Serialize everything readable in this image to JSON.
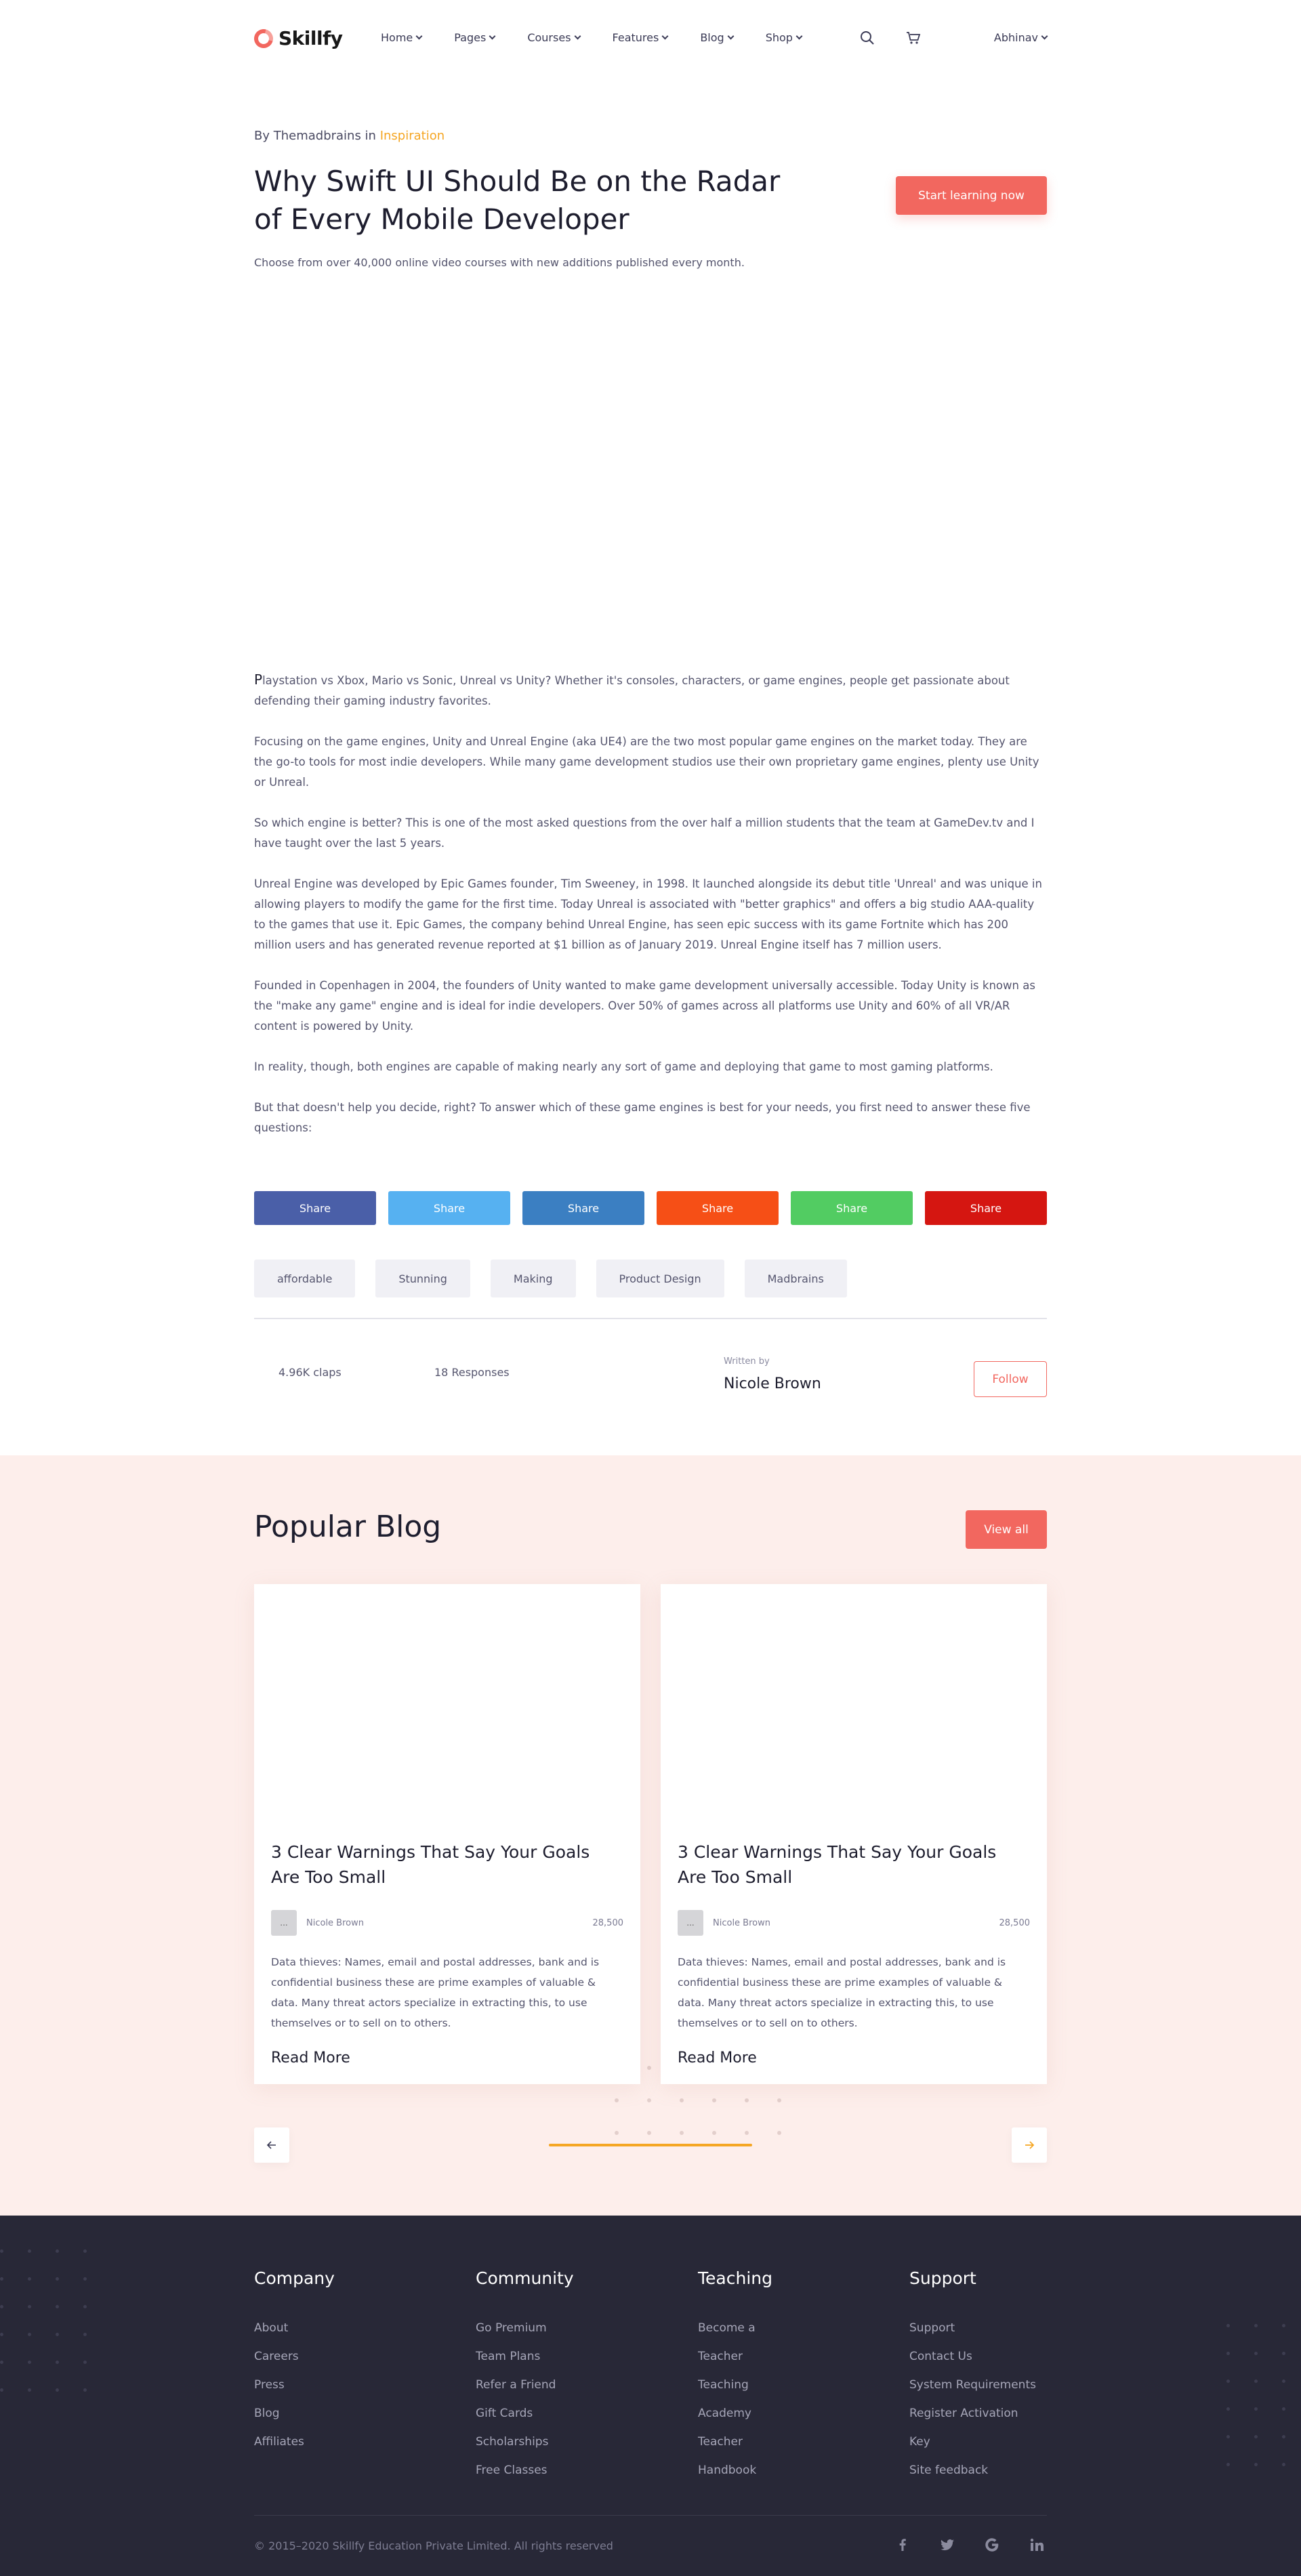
{
  "brand": {
    "name": "Skillfy",
    "accent": "#f2675f",
    "highlight": "#f5a623"
  },
  "nav": {
    "items": [
      "Home",
      "Pages",
      "Courses",
      "Features",
      "Blog",
      "Shop"
    ],
    "search_icon": "search-icon",
    "cart_icon": "cart-icon",
    "user": "Abhinav"
  },
  "hero": {
    "by_prefix": "By Themadbrains in",
    "category": "Inspiration",
    "title": "Why Swift UI Should Be on  the Radar of Every Mobile Developer",
    "subtitle": "Choose from over 40,000 online video courses with new additions published every month.",
    "cta": "Start learning now"
  },
  "article": {
    "dropcap": "P",
    "first_rest": "laystation vs Xbox, Mario vs Sonic, Unreal vs Unity? Whether it's consoles, characters, or game engines, people get passionate about defending their gaming industry favorites.",
    "paragraphs": [
      "Focusing on the game engines, Unity and Unreal Engine (aka UE4) are the two most popular game engines on the market today. They are the go-to tools for most indie developers. While many game development studios use their own proprietary game engines, plenty use Unity or Unreal.",
      "So which engine is better? This is one of the most asked questions from the over half a million students that the team at GameDev.tv and I have taught over the last 5 years.",
      "Unreal Engine was developed by Epic Games founder, Tim Sweeney, in 1998. It launched alongside its debut title 'Unreal' and was unique in allowing players to modify the game for the first time. Today Unreal is associated with \"better graphics\" and offers a big studio AAA-quality to the games that use it. Epic Games, the company behind Unreal Engine, has seen epic success with its game Fortnite which has 200 million users and has generated revenue reported at $1 billion as of January 2019. Unreal Engine itself has 7 million users.",
      "Founded in Copenhagen in 2004, the founders of Unity wanted to make game development universally accessible. Today Unity is known as the \"make any game\" engine and is ideal for indie developers. Over 50% of games across all platforms use Unity and 60% of all VR/AR content is powered by Unity.",
      "In reality, though, both engines are capable of making nearly any sort of game and deploying that game to most gaming platforms.",
      "But that doesn't help you decide, right? To answer which of these game engines is best for your needs, you first need to answer these five questions:"
    ]
  },
  "share": {
    "label": "Share",
    "colors": [
      "#4a5fa8",
      "#56b1f1",
      "#3b7fc2",
      "#f64f16",
      "#52cc62",
      "#d51611"
    ]
  },
  "tags": [
    "affordable",
    "Stunning",
    "Making",
    "Product Design",
    "Madbrains"
  ],
  "author_bar": {
    "claps": "4.96K claps",
    "responses": "18 Responses",
    "written_by": "Written by",
    "author": "Nicole Brown",
    "follow": "Follow"
  },
  "popular": {
    "heading": "Popular Blog",
    "view_all": "View all",
    "cards": [
      {
        "title": "3 Clear Warnings That Say Your Goals Are Too Small",
        "avatar": "...",
        "author": "Nicole Brown",
        "views": "28,500",
        "text": "Data thieves: Names, email and postal addresses, bank and is confidential business these are prime examples of valuable & data. Many threat actors specialize in extracting this, to use themselves or to sell on to others.",
        "read_more": "Read More"
      },
      {
        "title": "3 Clear Warnings That Say Your Goals Are Too Small",
        "avatar": "...",
        "author": "Nicole Brown",
        "views": "28,500",
        "text": "Data thieves: Names, email and postal addresses, bank and is confidential business these are prime examples of valuable & data. Many threat actors specialize in extracting this, to use themselves or to sell on to others.",
        "read_more": "Read More"
      }
    ],
    "prev_icon": "arrow-left-icon",
    "next_icon": "arrow-right-icon"
  },
  "footer": {
    "columns": [
      {
        "title": "Company",
        "links": [
          "About",
          "Careers",
          "Press",
          "Blog",
          "Affiliates"
        ]
      },
      {
        "title": "Community",
        "links": [
          "Go Premium",
          "Team Plans",
          "Refer a Friend",
          "Gift Cards",
          "Scholarships",
          "Free Classes"
        ]
      },
      {
        "title": "Teaching",
        "links": [
          "Become a",
          "Teacher",
          "Teaching",
          "Academy",
          "Teacher",
          "Handbook"
        ]
      },
      {
        "title": "Support",
        "links": [
          "Support",
          "Contact Us",
          "System Requirements",
          "Register Activation",
          "Key",
          "Site feedback"
        ]
      }
    ],
    "copyright": "© 2015–2020 Skillfy Education Private Limited. All rights reserved",
    "social": [
      "facebook-icon",
      "twitter-icon",
      "google-icon",
      "linkedin-icon"
    ]
  }
}
